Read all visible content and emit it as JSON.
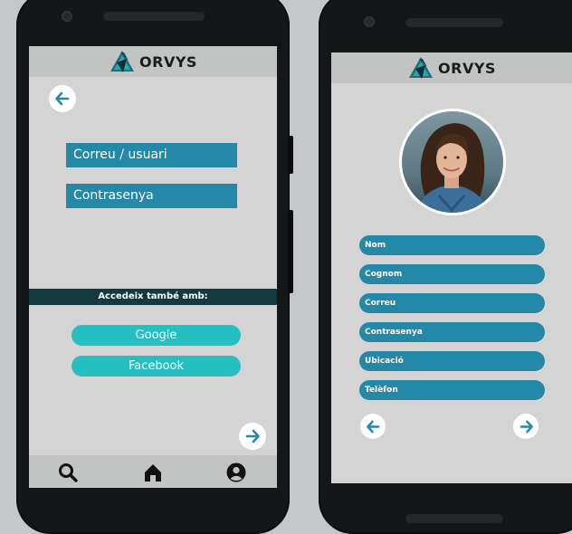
{
  "brand": {
    "name": "ORVYS"
  },
  "login": {
    "user_placeholder": "Correu / usuari",
    "password_placeholder": "Contrasenya",
    "alt_login_label": "Accedeix també amb:",
    "google_label": "Google",
    "facebook_label": "Facebook"
  },
  "profile": {
    "fields": [
      {
        "label": "Nom"
      },
      {
        "label": "Cognom"
      },
      {
        "label": "Correu"
      },
      {
        "label": "Contrasenya"
      },
      {
        "label": "Ubicació"
      },
      {
        "label": "Telèfon"
      }
    ]
  },
  "icons": {
    "back": "arrow-left-icon",
    "next": "arrow-right-icon",
    "search": "search-icon",
    "home": "home-icon",
    "user": "user-icon"
  },
  "colors": {
    "primary": "#2488a8",
    "accent": "#25bfc1",
    "dark_bar": "#143a40",
    "screen_bg": "#d3d4d3",
    "header_bg": "#c2c3c3"
  }
}
